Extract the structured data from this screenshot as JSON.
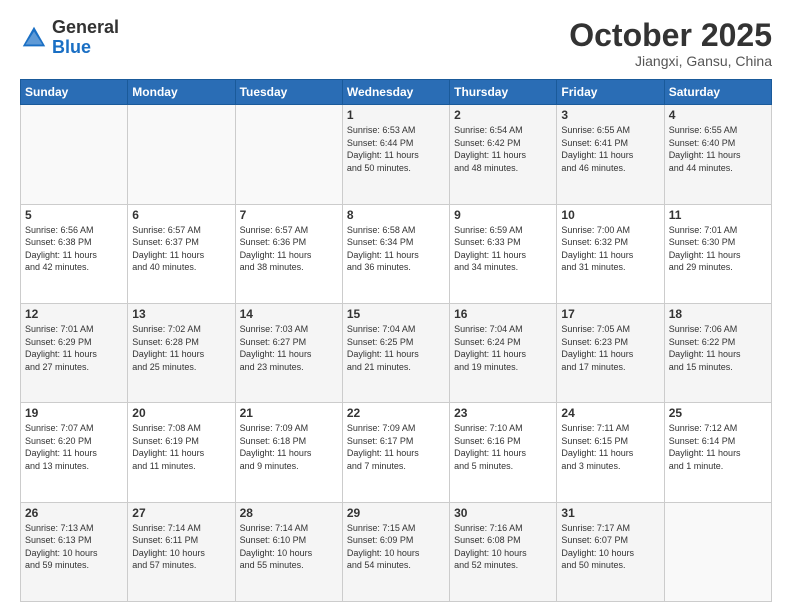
{
  "logo": {
    "general": "General",
    "blue": "Blue"
  },
  "header": {
    "month": "October 2025",
    "location": "Jiangxi, Gansu, China"
  },
  "days_of_week": [
    "Sunday",
    "Monday",
    "Tuesday",
    "Wednesday",
    "Thursday",
    "Friday",
    "Saturday"
  ],
  "weeks": [
    [
      {
        "day": "",
        "info": ""
      },
      {
        "day": "",
        "info": ""
      },
      {
        "day": "",
        "info": ""
      },
      {
        "day": "1",
        "info": "Sunrise: 6:53 AM\nSunset: 6:44 PM\nDaylight: 11 hours\nand 50 minutes."
      },
      {
        "day": "2",
        "info": "Sunrise: 6:54 AM\nSunset: 6:42 PM\nDaylight: 11 hours\nand 48 minutes."
      },
      {
        "day": "3",
        "info": "Sunrise: 6:55 AM\nSunset: 6:41 PM\nDaylight: 11 hours\nand 46 minutes."
      },
      {
        "day": "4",
        "info": "Sunrise: 6:55 AM\nSunset: 6:40 PM\nDaylight: 11 hours\nand 44 minutes."
      }
    ],
    [
      {
        "day": "5",
        "info": "Sunrise: 6:56 AM\nSunset: 6:38 PM\nDaylight: 11 hours\nand 42 minutes."
      },
      {
        "day": "6",
        "info": "Sunrise: 6:57 AM\nSunset: 6:37 PM\nDaylight: 11 hours\nand 40 minutes."
      },
      {
        "day": "7",
        "info": "Sunrise: 6:57 AM\nSunset: 6:36 PM\nDaylight: 11 hours\nand 38 minutes."
      },
      {
        "day": "8",
        "info": "Sunrise: 6:58 AM\nSunset: 6:34 PM\nDaylight: 11 hours\nand 36 minutes."
      },
      {
        "day": "9",
        "info": "Sunrise: 6:59 AM\nSunset: 6:33 PM\nDaylight: 11 hours\nand 34 minutes."
      },
      {
        "day": "10",
        "info": "Sunrise: 7:00 AM\nSunset: 6:32 PM\nDaylight: 11 hours\nand 31 minutes."
      },
      {
        "day": "11",
        "info": "Sunrise: 7:01 AM\nSunset: 6:30 PM\nDaylight: 11 hours\nand 29 minutes."
      }
    ],
    [
      {
        "day": "12",
        "info": "Sunrise: 7:01 AM\nSunset: 6:29 PM\nDaylight: 11 hours\nand 27 minutes."
      },
      {
        "day": "13",
        "info": "Sunrise: 7:02 AM\nSunset: 6:28 PM\nDaylight: 11 hours\nand 25 minutes."
      },
      {
        "day": "14",
        "info": "Sunrise: 7:03 AM\nSunset: 6:27 PM\nDaylight: 11 hours\nand 23 minutes."
      },
      {
        "day": "15",
        "info": "Sunrise: 7:04 AM\nSunset: 6:25 PM\nDaylight: 11 hours\nand 21 minutes."
      },
      {
        "day": "16",
        "info": "Sunrise: 7:04 AM\nSunset: 6:24 PM\nDaylight: 11 hours\nand 19 minutes."
      },
      {
        "day": "17",
        "info": "Sunrise: 7:05 AM\nSunset: 6:23 PM\nDaylight: 11 hours\nand 17 minutes."
      },
      {
        "day": "18",
        "info": "Sunrise: 7:06 AM\nSunset: 6:22 PM\nDaylight: 11 hours\nand 15 minutes."
      }
    ],
    [
      {
        "day": "19",
        "info": "Sunrise: 7:07 AM\nSunset: 6:20 PM\nDaylight: 11 hours\nand 13 minutes."
      },
      {
        "day": "20",
        "info": "Sunrise: 7:08 AM\nSunset: 6:19 PM\nDaylight: 11 hours\nand 11 minutes."
      },
      {
        "day": "21",
        "info": "Sunrise: 7:09 AM\nSunset: 6:18 PM\nDaylight: 11 hours\nand 9 minutes."
      },
      {
        "day": "22",
        "info": "Sunrise: 7:09 AM\nSunset: 6:17 PM\nDaylight: 11 hours\nand 7 minutes."
      },
      {
        "day": "23",
        "info": "Sunrise: 7:10 AM\nSunset: 6:16 PM\nDaylight: 11 hours\nand 5 minutes."
      },
      {
        "day": "24",
        "info": "Sunrise: 7:11 AM\nSunset: 6:15 PM\nDaylight: 11 hours\nand 3 minutes."
      },
      {
        "day": "25",
        "info": "Sunrise: 7:12 AM\nSunset: 6:14 PM\nDaylight: 11 hours\nand 1 minute."
      }
    ],
    [
      {
        "day": "26",
        "info": "Sunrise: 7:13 AM\nSunset: 6:13 PM\nDaylight: 10 hours\nand 59 minutes."
      },
      {
        "day": "27",
        "info": "Sunrise: 7:14 AM\nSunset: 6:11 PM\nDaylight: 10 hours\nand 57 minutes."
      },
      {
        "day": "28",
        "info": "Sunrise: 7:14 AM\nSunset: 6:10 PM\nDaylight: 10 hours\nand 55 minutes."
      },
      {
        "day": "29",
        "info": "Sunrise: 7:15 AM\nSunset: 6:09 PM\nDaylight: 10 hours\nand 54 minutes."
      },
      {
        "day": "30",
        "info": "Sunrise: 7:16 AM\nSunset: 6:08 PM\nDaylight: 10 hours\nand 52 minutes."
      },
      {
        "day": "31",
        "info": "Sunrise: 7:17 AM\nSunset: 6:07 PM\nDaylight: 10 hours\nand 50 minutes."
      },
      {
        "day": "",
        "info": ""
      }
    ]
  ]
}
